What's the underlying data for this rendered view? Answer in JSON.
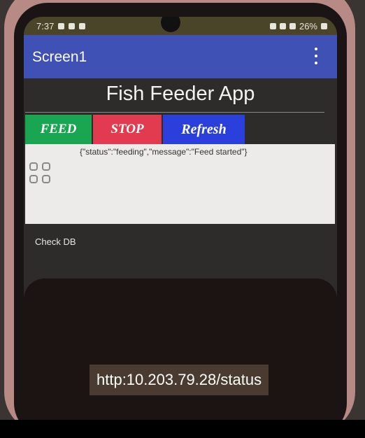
{
  "status_bar": {
    "time": "7:37",
    "battery": "26%"
  },
  "app_bar": {
    "title": "Screen1"
  },
  "main": {
    "heading": "Fish Feeder App",
    "buttons": {
      "feed": "FEED",
      "stop": "STOP",
      "refresh": "Refresh"
    },
    "response": "{\"status\":\"feeding\",\"message\":\"Feed started\"}",
    "check_db": "Check DB"
  },
  "caption": {
    "url": "http:10.203.79.28/status"
  },
  "colors": {
    "app_bar": "#3f51b5",
    "feed_button": "#1aa550",
    "stop_button": "#e23a4f",
    "refresh_button": "#2a3fdc"
  },
  "icons": [
    "menu-overflow-icon",
    "grid-icon",
    "wifi-icon",
    "signal-icon",
    "battery-icon"
  ]
}
